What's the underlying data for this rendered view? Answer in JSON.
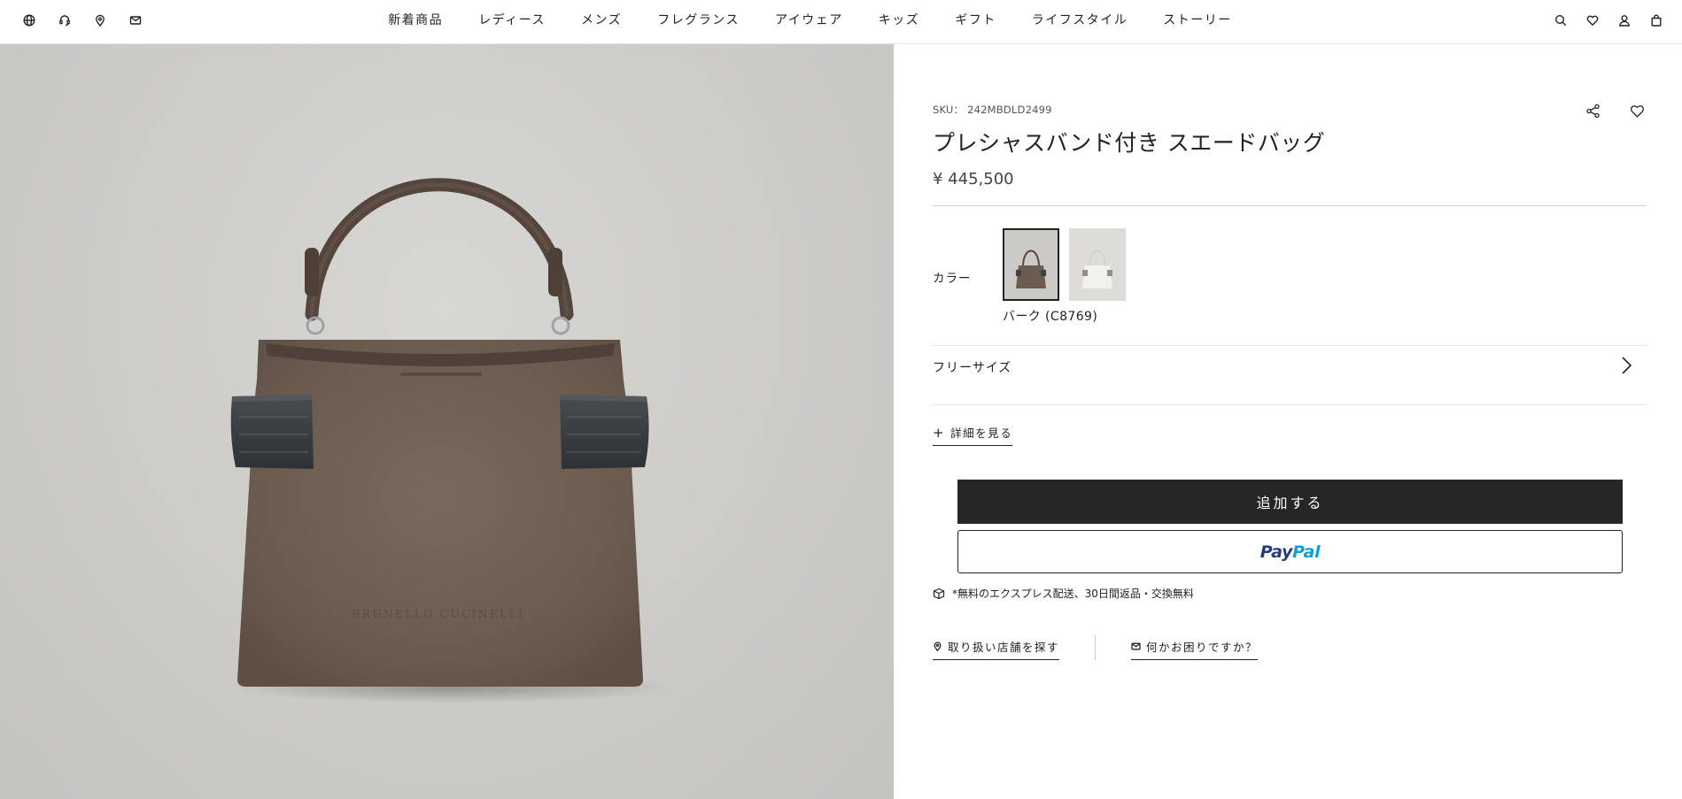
{
  "header": {
    "left_icons": [
      "globe-icon",
      "customer-service-icon",
      "location-pin-icon",
      "mail-icon"
    ],
    "nav_items": [
      "新着商品",
      "レディース",
      "メンズ",
      "フレグランス",
      "アイウェア",
      "キッズ",
      "ギフト",
      "ライフスタイル",
      "ストーリー"
    ],
    "right_icons": [
      "search-icon",
      "heart-icon",
      "user-icon",
      "shopping-bag-icon"
    ]
  },
  "product": {
    "sku": "SKU： 242MBDLD2499",
    "title": "プレシャスバンド付き スエードバッグ",
    "price": "¥ 445,500",
    "image_brand_text": "BRUNELLO CUCINELLI",
    "color_label": "カラー",
    "color_options": [
      {
        "name": "バーク (C8769)",
        "swatch_color": "#6f5e52",
        "selected": true
      },
      {
        "name": "",
        "swatch_color": "#e9e6e1",
        "selected": false
      }
    ],
    "selected_color": "バーク (C8769)",
    "size_label": "フリーサイズ",
    "details_label": "詳細を見る",
    "add_to_cart": "追加する",
    "paypal": {
      "pay": "Pay",
      "pal": "Pal"
    },
    "shipping_note": "*無料のエクスプレス配送、30日間返品・交換無料",
    "store_link": "取り扱い店舗を探す",
    "help_link": "何かお困りですか？"
  },
  "colors": {
    "accent_dark": "#262626",
    "paypal_blue_dark": "#253b80",
    "paypal_blue_light": "#179bd7",
    "bag_suede": "#6f5e52",
    "bag_band": "#3d4145",
    "image_background": "#cecdca"
  }
}
